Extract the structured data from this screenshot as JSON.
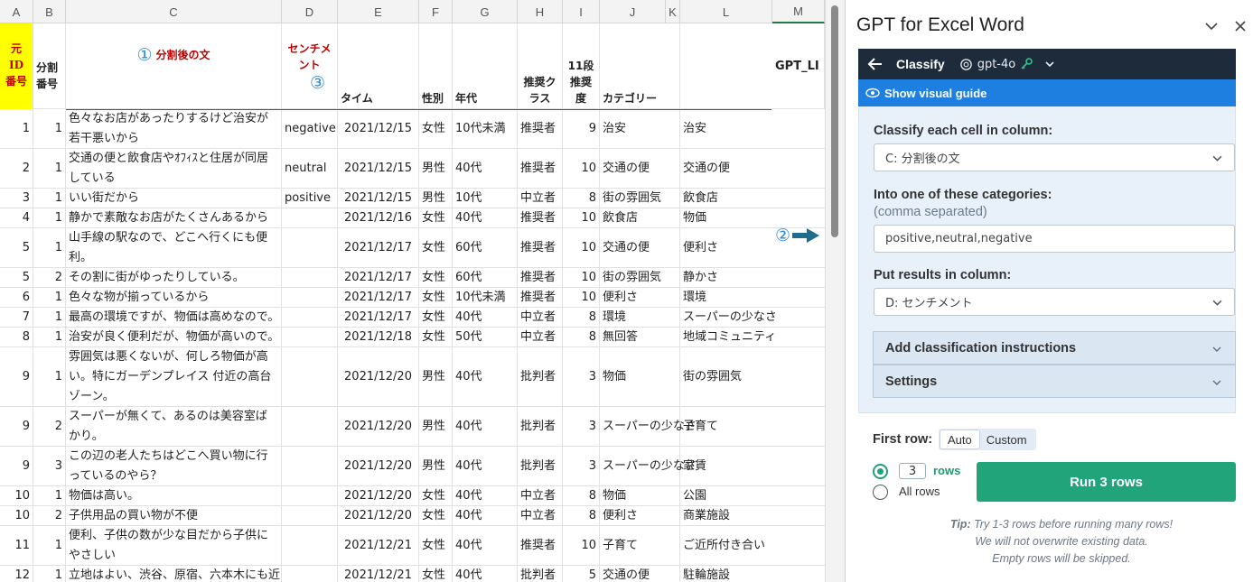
{
  "sheet": {
    "columns": [
      "A",
      "B",
      "C",
      "D",
      "E",
      "F",
      "G",
      "H",
      "I",
      "J",
      "K",
      "L",
      "M"
    ],
    "header": {
      "a": [
        "元",
        "ID",
        "番号"
      ],
      "b": [
        "分割",
        "番号"
      ],
      "c_marker": "①",
      "c": "分割後の文",
      "d_line1": "センチメ",
      "d_line2": "ント",
      "d_marker": "③",
      "e": "タイム",
      "f": "性別",
      "g": "年代",
      "h": "推奨クラス",
      "i": "11段推奨度",
      "j": "カテゴリー",
      "k": "",
      "l": "",
      "m": "GPT_LI"
    },
    "arrow_marker": "②",
    "rows": [
      {
        "a": "1",
        "b": "1",
        "c": "色々なお店があったりするけど治安が若干悪いから",
        "d": "negative",
        "e": "2021/12/15",
        "f": "女性",
        "g": "10代未満",
        "h": "推奨者",
        "i": "9",
        "j": "治安",
        "l": "治安"
      },
      {
        "a": "2",
        "b": "1",
        "c": "交通の便と飲食店やｵﾌｨｽと住居が同居している",
        "d": "neutral",
        "e": "2021/12/15",
        "f": "男性",
        "g": "40代",
        "h": "推奨者",
        "i": "10",
        "j": "交通の便",
        "l": "交通の便"
      },
      {
        "a": "3",
        "b": "1",
        "c": "いい街だから",
        "d": "positive",
        "e": "2021/12/15",
        "f": "男性",
        "g": "10代",
        "h": "中立者",
        "i": "8",
        "j": "街の雰囲気",
        "l": "飲食店"
      },
      {
        "a": "4",
        "b": "1",
        "c": "静かで素敵なお店がたくさんあるから",
        "d": "",
        "e": "2021/12/16",
        "f": "女性",
        "g": "40代",
        "h": "推奨者",
        "i": "10",
        "j": "飲食店",
        "l": "物価"
      },
      {
        "a": "5",
        "b": "1",
        "c": "山手線の駅なので、どこへ行くにも便利。",
        "d": "",
        "e": "2021/12/17",
        "f": "女性",
        "g": "60代",
        "h": "推奨者",
        "i": "10",
        "j": "交通の便",
        "l": "便利さ"
      },
      {
        "a": "5",
        "b": "2",
        "c": "その割に街がゆったりしている。",
        "d": "",
        "e": "2021/12/17",
        "f": "女性",
        "g": "60代",
        "h": "推奨者",
        "i": "10",
        "j": "街の雰囲気",
        "l": "静かさ"
      },
      {
        "a": "6",
        "b": "1",
        "c": "色々な物が揃っているから",
        "d": "",
        "e": "2021/12/17",
        "f": "女性",
        "g": "10代未満",
        "h": "推奨者",
        "i": "10",
        "j": "便利さ",
        "l": "環境"
      },
      {
        "a": "7",
        "b": "1",
        "c": "最高の環境ですが、物価は高めなので。",
        "d": "",
        "e": "2021/12/17",
        "f": "女性",
        "g": "40代",
        "h": "中立者",
        "i": "8",
        "j": "環境",
        "l": "スーパーの少なさ"
      },
      {
        "a": "8",
        "b": "1",
        "c": "治安が良く便利だが、物価が高いので。",
        "d": "",
        "e": "2021/12/18",
        "f": "女性",
        "g": "50代",
        "h": "中立者",
        "i": "8",
        "j": "無回答",
        "l": "地域コミュニティ"
      },
      {
        "a": "9",
        "b": "1",
        "c": "雰囲気は悪くないが、何しろ物価が高い。特にガーデンプレイス 付近の高台ゾーン。",
        "d": "",
        "e": "2021/12/20",
        "f": "男性",
        "g": "40代",
        "h": "批判者",
        "i": "3",
        "j": "物価",
        "l": "街の雰囲気"
      },
      {
        "a": "9",
        "b": "2",
        "c": "スーパーが無くて、あるのは美容室ばかり。",
        "d": "",
        "e": "2021/12/20",
        "f": "男性",
        "g": "40代",
        "h": "批判者",
        "i": "3",
        "j": "スーパーの少なさ",
        "l": "子育て"
      },
      {
        "a": "9",
        "b": "3",
        "c": "この辺の老人たちはどこへ買い物に行っているのやら？",
        "d": "",
        "e": "2021/12/20",
        "f": "男性",
        "g": "40代",
        "h": "批判者",
        "i": "3",
        "j": "スーパーの少なさ",
        "l": "家賃"
      },
      {
        "a": "10",
        "b": "1",
        "c": "物価は高い。",
        "d": "",
        "e": "2021/12/20",
        "f": "女性",
        "g": "40代",
        "h": "中立者",
        "i": "8",
        "j": "物価",
        "l": "公園"
      },
      {
        "a": "10",
        "b": "2",
        "c": "子供用品の買い物が不便",
        "d": "",
        "e": "2021/12/20",
        "f": "女性",
        "g": "40代",
        "h": "中立者",
        "i": "8",
        "j": "便利さ",
        "l": "商業施設"
      },
      {
        "a": "11",
        "b": "1",
        "c": "便利、子供の数が少な目だから子供にやさしい",
        "d": "",
        "e": "2021/12/21",
        "f": "女性",
        "g": "40代",
        "h": "推奨者",
        "i": "10",
        "j": "子育て",
        "l": "ご近所付き合い"
      },
      {
        "a": "12",
        "b": "1",
        "c": "立地はよい、渋谷、原宿、六本木にも近",
        "d": "",
        "e": "2021/12/21",
        "f": "女性",
        "g": "40代",
        "h": "批判者",
        "i": "5",
        "j": "交通の便",
        "l": "駐輪施設"
      }
    ]
  },
  "panel": {
    "title": "GPT for Excel Word",
    "bar_title": "Classify",
    "model": "gpt-4o",
    "guide": "Show visual guide",
    "classify_label": "Classify each cell in column:",
    "classify_value": "C: 分割後の文",
    "categories_label": "Into one of these categories:",
    "categories_sub": "(comma separated)",
    "categories_value": "positive,neutral,negative",
    "results_label": "Put results in column:",
    "results_value": "D: センチメント",
    "instructions_label": "Add classification instructions",
    "settings_label": "Settings",
    "first_row_label": "First row:",
    "first_row_options": [
      "Auto",
      "Custom"
    ],
    "rows_count": "3",
    "rows_label": "rows",
    "all_rows_label": "All rows",
    "run_label": "Run 3 rows",
    "tip_bold": "Tip:",
    "tip_line1": " Try 1-3 rows before running many rows!",
    "tip_line2": "We will not overwrite existing data.",
    "tip_line3": "Empty rows will be skipped."
  },
  "colors": {
    "accent_green": "#21a47a",
    "nav_dark": "#1d2b3a",
    "guide_blue": "#1e7fe0",
    "header_red": "#c00000",
    "marker_blue": "#2f8ad6",
    "highlight_yellow": "#ffff00"
  }
}
